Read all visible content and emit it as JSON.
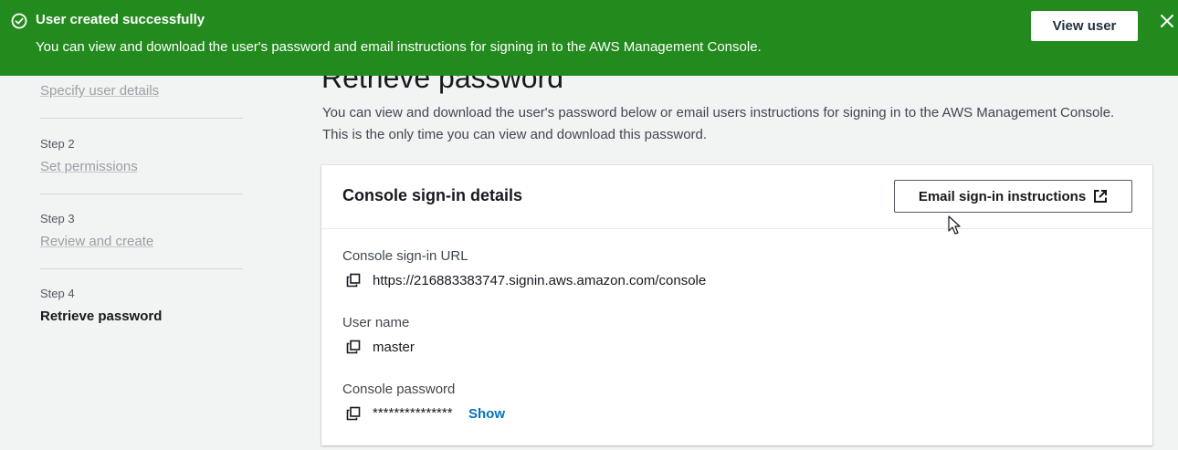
{
  "flash": {
    "title": "User created successfully",
    "message": "You can view and download the user's password and email instructions for signing in to the AWS Management Console.",
    "view_button": "View user",
    "color": "#238a1e",
    "icons": {
      "status": "check-circle-icon",
      "dismiss": "close-icon"
    }
  },
  "sidebar": {
    "steps": [
      {
        "number": "",
        "label": "Specify user details",
        "state": "link"
      },
      {
        "number": "Step 2",
        "label": "Set permissions",
        "state": "link"
      },
      {
        "number": "Step 3",
        "label": "Review and create",
        "state": "link"
      },
      {
        "number": "Step 4",
        "label": "Retrieve password",
        "state": "current"
      }
    ]
  },
  "main": {
    "title": "Retrieve password",
    "description_line1": "You can view and download the user's password below or email users instructions for signing in to the AWS Management Console.",
    "description_line2": "This is the only time you can view and download this password."
  },
  "card": {
    "title": "Console sign-in details",
    "email_button": "Email sign-in instructions",
    "fields": [
      {
        "label": "Console sign-in URL",
        "value": "https://216883383747.signin.aws.amazon.com/console"
      },
      {
        "label": "User name",
        "value": "master"
      },
      {
        "label": "Console password",
        "value": "***************",
        "action": "Show"
      }
    ]
  }
}
